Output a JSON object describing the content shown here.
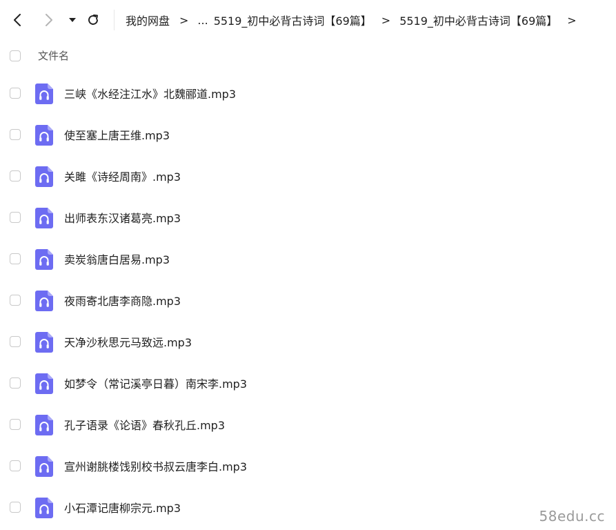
{
  "breadcrumb": {
    "items": [
      {
        "label": "我的网盘"
      },
      {
        "label": "..."
      },
      {
        "label": "5519_初中必背古诗词【69篇】"
      },
      {
        "label": "5519_初中必背古诗词【69篇】"
      }
    ],
    "separator": ">"
  },
  "list_header": {
    "name_label": "文件名"
  },
  "files": [
    {
      "name": "三峡《水经注江水》北魏郦道.mp3",
      "icon": "audio-file-icon"
    },
    {
      "name": "使至塞上唐王维.mp3",
      "icon": "audio-file-icon"
    },
    {
      "name": "关雎《诗经周南》.mp3",
      "icon": "audio-file-icon"
    },
    {
      "name": "出师表东汉诸葛亮.mp3",
      "icon": "audio-file-icon"
    },
    {
      "name": "卖炭翁唐白居易.mp3",
      "icon": "audio-file-icon"
    },
    {
      "name": "夜雨寄北唐李商隐.mp3",
      "icon": "audio-file-icon"
    },
    {
      "name": "天净沙秋思元马致远.mp3",
      "icon": "audio-file-icon"
    },
    {
      "name": "如梦令（常记溪亭日暮）南宋李.mp3",
      "icon": "audio-file-icon"
    },
    {
      "name": "孔子语录《论语》春秋孔丘.mp3",
      "icon": "audio-file-icon"
    },
    {
      "name": "宣州谢朓楼饯别校书叔云唐李白.mp3",
      "icon": "audio-file-icon"
    },
    {
      "name": "小石潭记唐柳宗元.mp3",
      "icon": "audio-file-icon"
    }
  ],
  "watermark": "58edu.cc",
  "colors": {
    "audio_icon": "#6d6cf2",
    "checkbox_border": "#c8c8c8",
    "text": "#1f1f1f"
  }
}
